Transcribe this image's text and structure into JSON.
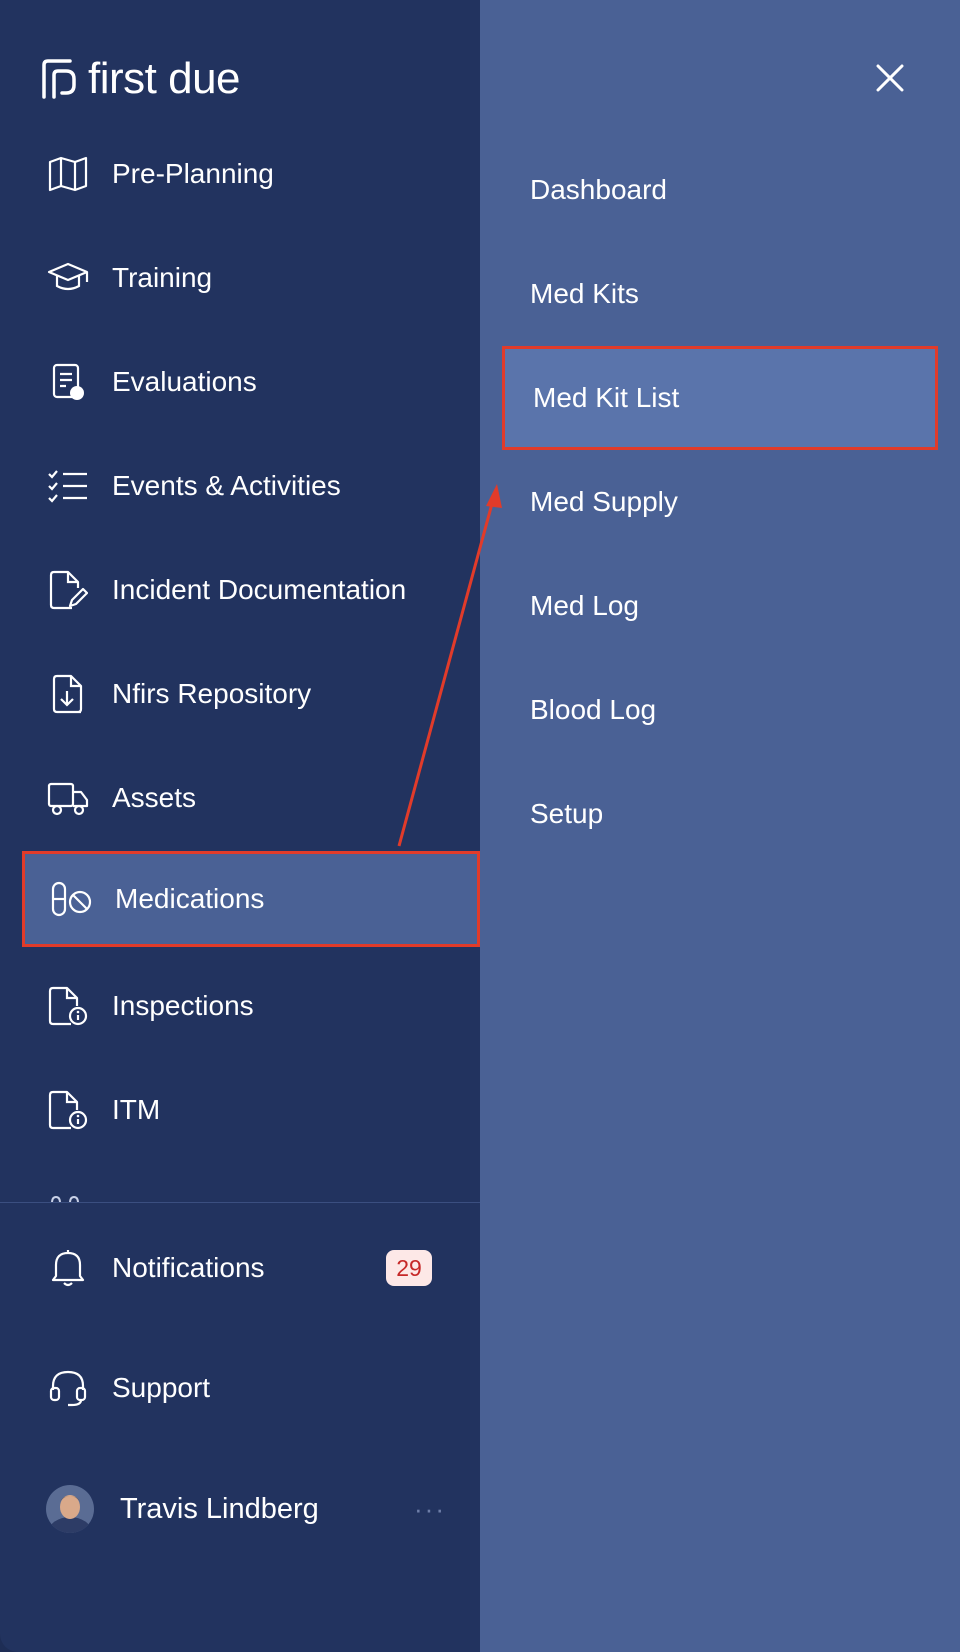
{
  "brand": {
    "name": "first due"
  },
  "nav": {
    "items": [
      {
        "label": "Pre-Planning",
        "icon": "map-icon"
      },
      {
        "label": "Training",
        "icon": "graduation-cap-icon"
      },
      {
        "label": "Evaluations",
        "icon": "evaluation-icon"
      },
      {
        "label": "Events & Activities",
        "icon": "checklist-icon"
      },
      {
        "label": "Incident Documentation",
        "icon": "document-edit-icon"
      },
      {
        "label": "Nfirs Repository",
        "icon": "file-download-icon"
      },
      {
        "label": "Assets",
        "icon": "truck-icon"
      },
      {
        "label": "Medications",
        "icon": "pill-icon",
        "active": true
      },
      {
        "label": "Inspections",
        "icon": "file-info-icon"
      },
      {
        "label": "ITM",
        "icon": "file-info-icon"
      }
    ]
  },
  "footer": {
    "notifications": {
      "label": "Notifications",
      "count": "29"
    },
    "support": {
      "label": "Support"
    },
    "user": {
      "name": "Travis Lindberg",
      "more": "···"
    }
  },
  "submenu": {
    "items": [
      {
        "label": "Dashboard"
      },
      {
        "label": "Med Kits"
      },
      {
        "label": "Med Kit List",
        "active": true
      },
      {
        "label": "Med Supply"
      },
      {
        "label": "Med Log"
      },
      {
        "label": "Blood Log"
      },
      {
        "label": "Setup"
      }
    ]
  },
  "colors": {
    "sidebar_bg": "#22335f",
    "submenu_bg": "#4a6195",
    "highlight_border": "#e13b2a",
    "badge_bg": "#fde8e7",
    "badge_text": "#c62828"
  }
}
